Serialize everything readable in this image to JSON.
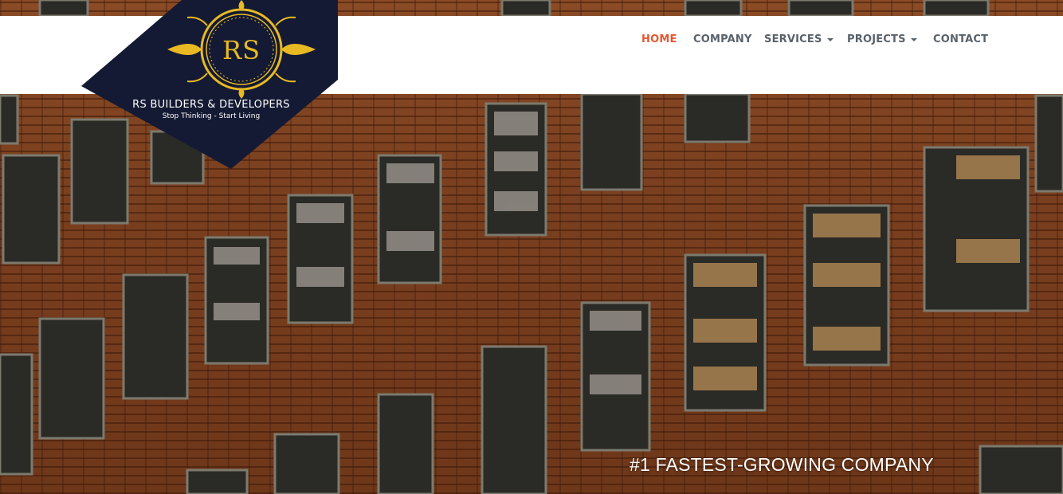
{
  "brand": {
    "monogram": "RS",
    "name": "RS BUILDERS & DEVELOPERS",
    "tagline": "Stop Thinking - Start Living",
    "accent_color": "#e8b923",
    "badge_color": "#141a33"
  },
  "nav": {
    "items": [
      {
        "label": "HOME",
        "active": true
      },
      {
        "label": "COMPANY",
        "active": false
      },
      {
        "label": "SERVICES",
        "dropdown": true
      },
      {
        "label": "PROJECTS",
        "dropdown": true
      },
      {
        "label": "CONTACT",
        "active": false
      }
    ],
    "active_color": "#e4572e",
    "text_color": "#59626b"
  },
  "hero": {
    "headline": "#1 FASTEST-GROWING COMPANY",
    "background": "brick building facade with windows"
  }
}
